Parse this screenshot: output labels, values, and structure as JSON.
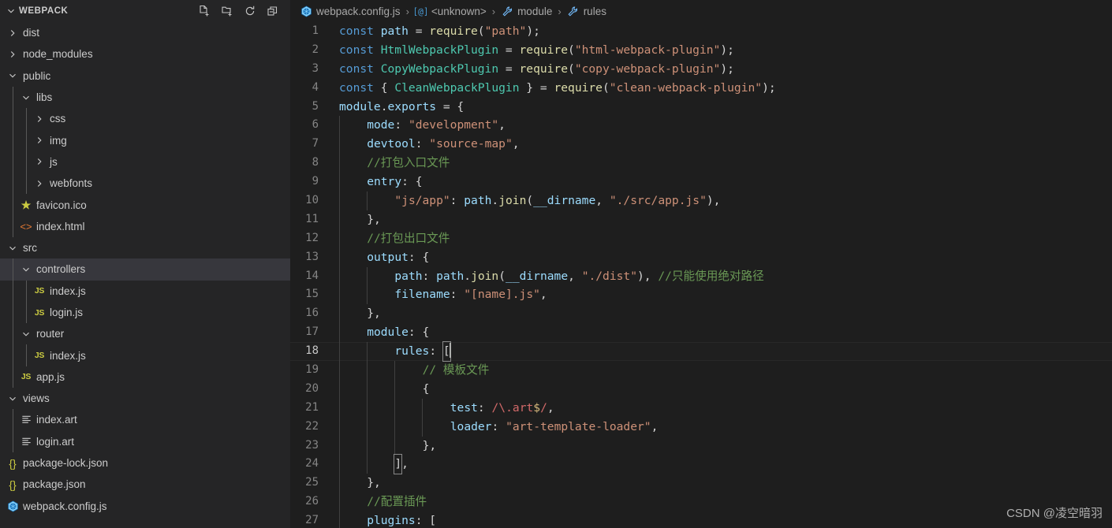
{
  "sidebar": {
    "title": "WEBPACK",
    "actions": [
      {
        "name": "new-file-icon",
        "label": "New File"
      },
      {
        "name": "new-folder-icon",
        "label": "New Folder"
      },
      {
        "name": "refresh-icon",
        "label": "Refresh Explorer"
      },
      {
        "name": "collapse-all-icon",
        "label": "Collapse Folders in Explorer"
      }
    ],
    "items": [
      {
        "label": "dist",
        "kind": "folder",
        "expanded": false,
        "depth": 0,
        "selected": false
      },
      {
        "label": "node_modules",
        "kind": "folder",
        "expanded": false,
        "depth": 0,
        "selected": false
      },
      {
        "label": "public",
        "kind": "folder",
        "expanded": true,
        "depth": 0,
        "selected": false
      },
      {
        "label": "libs",
        "kind": "folder",
        "expanded": true,
        "depth": 1,
        "selected": false
      },
      {
        "label": "css",
        "kind": "folder",
        "expanded": false,
        "depth": 2,
        "selected": false
      },
      {
        "label": "img",
        "kind": "folder",
        "expanded": false,
        "depth": 2,
        "selected": false
      },
      {
        "label": "js",
        "kind": "folder",
        "expanded": false,
        "depth": 2,
        "selected": false
      },
      {
        "label": "webfonts",
        "kind": "folder",
        "expanded": false,
        "depth": 2,
        "selected": false
      },
      {
        "label": "favicon.ico",
        "kind": "file",
        "icon": "star-icon",
        "depth": 1,
        "selected": false
      },
      {
        "label": "index.html",
        "kind": "file",
        "icon": "html-icon",
        "depth": 1,
        "selected": false
      },
      {
        "label": "src",
        "kind": "folder",
        "expanded": true,
        "depth": 0,
        "selected": false
      },
      {
        "label": "controllers",
        "kind": "folder",
        "expanded": true,
        "depth": 1,
        "selected": true
      },
      {
        "label": "index.js",
        "kind": "file",
        "icon": "js-icon",
        "depth": 2,
        "selected": false
      },
      {
        "label": "login.js",
        "kind": "file",
        "icon": "js-icon",
        "depth": 2,
        "selected": false
      },
      {
        "label": "router",
        "kind": "folder",
        "expanded": true,
        "depth": 1,
        "selected": false
      },
      {
        "label": "index.js",
        "kind": "file",
        "icon": "js-icon",
        "depth": 2,
        "selected": false
      },
      {
        "label": "app.js",
        "kind": "file",
        "icon": "js-icon",
        "depth": 1,
        "selected": false
      },
      {
        "label": "views",
        "kind": "folder",
        "expanded": true,
        "depth": 0,
        "selected": false
      },
      {
        "label": "index.art",
        "kind": "file",
        "icon": "art-icon",
        "depth": 1,
        "selected": false
      },
      {
        "label": "login.art",
        "kind": "file",
        "icon": "art-icon",
        "depth": 1,
        "selected": false
      },
      {
        "label": "package-lock.json",
        "kind": "file",
        "icon": "json-icon",
        "depth": 0,
        "selected": false
      },
      {
        "label": "package.json",
        "kind": "file",
        "icon": "json-icon",
        "depth": 0,
        "selected": false
      },
      {
        "label": "webpack.config.js",
        "kind": "file",
        "icon": "webpack-icon",
        "depth": 0,
        "selected": false
      }
    ]
  },
  "breadcrumb": [
    {
      "label": "webpack.config.js",
      "icon": "webpack-icon"
    },
    {
      "label": "<unknown>",
      "icon": "symbol-module-icon"
    },
    {
      "label": "module",
      "icon": "symbol-property-icon"
    },
    {
      "label": "rules",
      "icon": "symbol-property-icon"
    }
  ],
  "breadcrumb_separator": "›",
  "editor": {
    "active_line": 18,
    "first_line": 1,
    "lines": [
      {
        "n": 1,
        "text": "const path = require(\"path\");"
      },
      {
        "n": 2,
        "text": "const HtmlWebpackPlugin = require(\"html-webpack-plugin\");"
      },
      {
        "n": 3,
        "text": "const CopyWebpackPlugin = require(\"copy-webpack-plugin\");"
      },
      {
        "n": 4,
        "text": "const { CleanWebpackPlugin } = require(\"clean-webpack-plugin\");"
      },
      {
        "n": 5,
        "text": "module.exports = {"
      },
      {
        "n": 6,
        "text": "    mode: \"development\","
      },
      {
        "n": 7,
        "text": "    devtool: \"source-map\","
      },
      {
        "n": 8,
        "text": "    //打包入口文件"
      },
      {
        "n": 9,
        "text": "    entry: {"
      },
      {
        "n": 10,
        "text": "        \"js/app\": path.join(__dirname, \"./src/app.js\"),"
      },
      {
        "n": 11,
        "text": "    },"
      },
      {
        "n": 12,
        "text": "    //打包出口文件"
      },
      {
        "n": 13,
        "text": "    output: {"
      },
      {
        "n": 14,
        "text": "        path: path.join(__dirname, \"./dist\"), //只能使用绝对路径"
      },
      {
        "n": 15,
        "text": "        filename: \"[name].js\","
      },
      {
        "n": 16,
        "text": "    },"
      },
      {
        "n": 17,
        "text": "    module: {"
      },
      {
        "n": 18,
        "text": "        rules: ["
      },
      {
        "n": 19,
        "text": "            // 模板文件"
      },
      {
        "n": 20,
        "text": "            {"
      },
      {
        "n": 21,
        "text": "                test: /\\.art$/,"
      },
      {
        "n": 22,
        "text": "                loader: \"art-template-loader\","
      },
      {
        "n": 23,
        "text": "            },"
      },
      {
        "n": 24,
        "text": "        ],"
      },
      {
        "n": 25,
        "text": "    },"
      },
      {
        "n": 26,
        "text": "    //配置插件"
      },
      {
        "n": 27,
        "text": "    plugins: ["
      }
    ]
  },
  "watermark": "CSDN @凌空暗羽",
  "colors": {
    "sidebar_bg": "#252526",
    "editor_bg": "#1e1e1e",
    "selection_bg": "#37373d",
    "keyword": "#569cd6",
    "variable": "#9cdcfe",
    "class": "#4ec9b0",
    "function": "#dcdcaa",
    "string": "#ce9178",
    "comment": "#6a9955",
    "punctuation": "#d4d4d4",
    "line_number": "#858585",
    "js_icon": "#cbcb41",
    "html_icon": "#e37933",
    "webpack_icon": "#519aba"
  }
}
